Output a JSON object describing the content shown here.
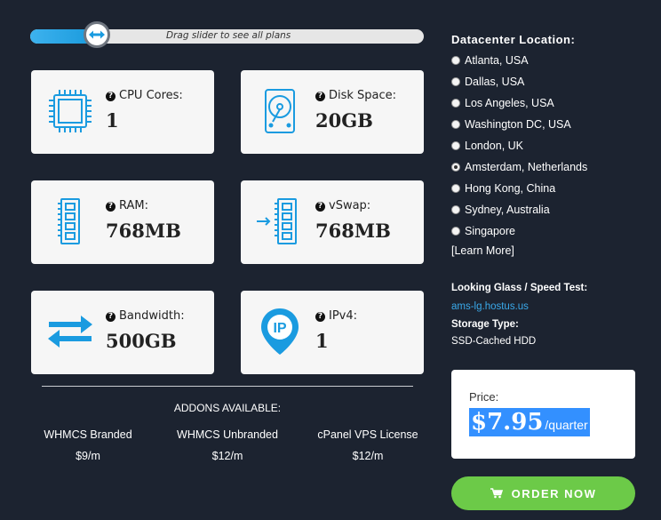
{
  "slider": {
    "hint": "Drag slider to see all plans",
    "position": 0.17
  },
  "specs": [
    {
      "icon": "cpu-icon",
      "label": "CPU Cores:",
      "value": "1"
    },
    {
      "icon": "disk-icon",
      "label": "Disk Space:",
      "value": "20GB"
    },
    {
      "icon": "ram-icon",
      "label": "RAM:",
      "value": "768MB"
    },
    {
      "icon": "vswap-icon",
      "label": "vSwap:",
      "value": "768MB"
    },
    {
      "icon": "bandwidth-icon",
      "label": "Bandwidth:",
      "value": "500GB"
    },
    {
      "icon": "ip-pin-icon",
      "label": "IPv4:",
      "value": "1"
    }
  ],
  "addons": {
    "title": "ADDONS AVAILABLE:",
    "items": [
      {
        "name": "WHMCS Branded",
        "price": "$9/m"
      },
      {
        "name": "WHMCS Unbranded",
        "price": "$12/m"
      },
      {
        "name": "cPanel VPS License",
        "price": "$12/m"
      }
    ]
  },
  "datacenter": {
    "title": "Datacenter Location:",
    "locations": [
      {
        "name": "Atlanta, USA",
        "checked": false
      },
      {
        "name": "Dallas, USA",
        "checked": false
      },
      {
        "name": "Los Angeles, USA",
        "checked": false
      },
      {
        "name": "Washington DC, USA",
        "checked": false
      },
      {
        "name": "London, UK",
        "checked": false
      },
      {
        "name": "Amsterdam, Netherlands",
        "checked": true
      },
      {
        "name": "Hong Kong, China",
        "checked": false
      },
      {
        "name": "Sydney, Australia",
        "checked": false
      },
      {
        "name": "Singapore",
        "checked": false
      }
    ],
    "learn_more": "[Learn More]"
  },
  "looking_glass": {
    "title": "Looking Glass / Speed Test:",
    "link": "ams-lg.hostus.us"
  },
  "storage": {
    "title": "Storage Type:",
    "value": "SSD-Cached HDD"
  },
  "price": {
    "label": "Price:",
    "amount": "$7.95",
    "period": "/quarter"
  },
  "order": {
    "label": "ORDER NOW",
    "icon": "cart-icon"
  },
  "colors": {
    "accent": "#1a9be0",
    "order": "#6cca48",
    "background": "#1c2330",
    "highlight": "#3390ff"
  }
}
